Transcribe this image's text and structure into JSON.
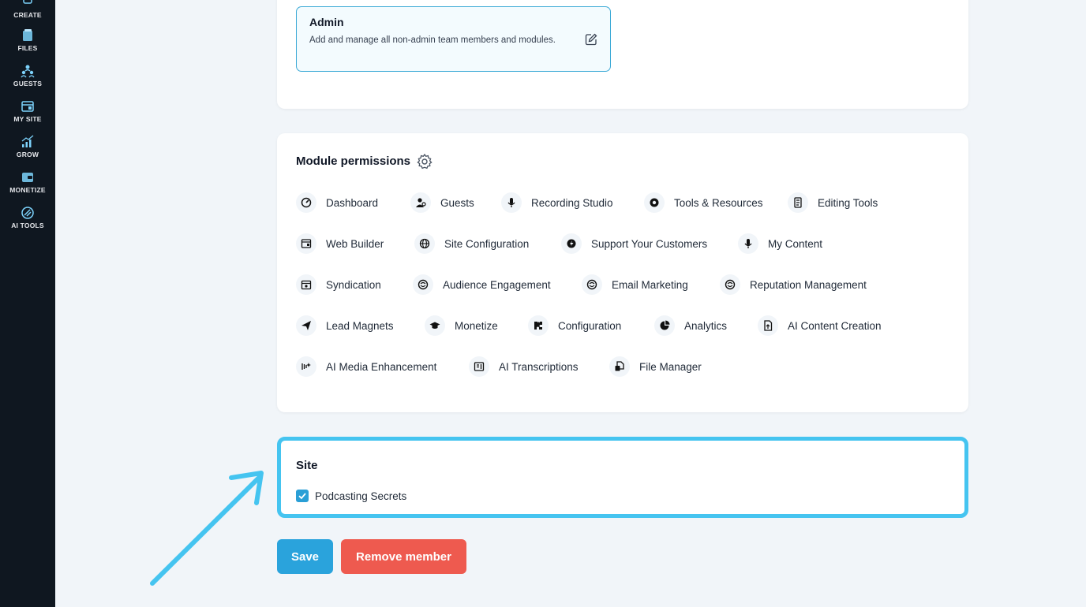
{
  "sidebar": {
    "items": [
      {
        "label": "CREATE",
        "icon": "create-icon"
      },
      {
        "label": "FILES",
        "icon": "files-icon"
      },
      {
        "label": "GUESTS",
        "icon": "guests-icon"
      },
      {
        "label": "MY SITE",
        "icon": "my-site-icon"
      },
      {
        "label": "GROW",
        "icon": "grow-icon"
      },
      {
        "label": "MONETIZE",
        "icon": "monetize-icon"
      },
      {
        "label": "AI TOOLS",
        "icon": "ai-tools-icon"
      }
    ]
  },
  "role": {
    "title": "Admin",
    "description": "Add and manage all non-admin team members and modules."
  },
  "modules": {
    "title": "Module permissions",
    "items": [
      {
        "label": "Dashboard",
        "icon": "dashboard-icon"
      },
      {
        "label": "Guests",
        "icon": "guests-icon"
      },
      {
        "label": "Recording Studio",
        "icon": "microphone-icon"
      },
      {
        "label": "Tools & Resources",
        "icon": "tools-icon"
      },
      {
        "label": "Editing Tools",
        "icon": "editing-icon"
      },
      {
        "label": "Web Builder",
        "icon": "web-builder-icon"
      },
      {
        "label": "Site Configuration",
        "icon": "globe-icon"
      },
      {
        "label": "Support Your Customers",
        "icon": "support-icon"
      },
      {
        "label": "My Content",
        "icon": "microphone-icon"
      },
      {
        "label": "Syndication",
        "icon": "calendar-icon"
      },
      {
        "label": "Audience Engagement",
        "icon": "engagement-icon"
      },
      {
        "label": "Email Marketing",
        "icon": "engagement-icon"
      },
      {
        "label": "Reputation Management",
        "icon": "engagement-icon"
      },
      {
        "label": "Lead Magnets",
        "icon": "send-icon"
      },
      {
        "label": "Monetize",
        "icon": "graduation-cap-icon"
      },
      {
        "label": "Configuration",
        "icon": "puzzle-icon"
      },
      {
        "label": "Analytics",
        "icon": "pie-chart-icon"
      },
      {
        "label": "AI Content Creation",
        "icon": "document-icon"
      },
      {
        "label": "AI Media Enhancement",
        "icon": "sparkle-icon"
      },
      {
        "label": "AI Transcriptions",
        "icon": "transcription-icon"
      },
      {
        "label": "File Manager",
        "icon": "file-manager-icon"
      }
    ]
  },
  "site": {
    "title": "Site",
    "checkbox_label": "Podcasting Secrets",
    "checked": true
  },
  "actions": {
    "save_label": "Save",
    "remove_label": "Remove member"
  },
  "colors": {
    "sidebar_bg": "#0f1720",
    "accent": "#2aa3dc",
    "danger": "#ee5a4f",
    "highlight": "#45c4f0"
  }
}
